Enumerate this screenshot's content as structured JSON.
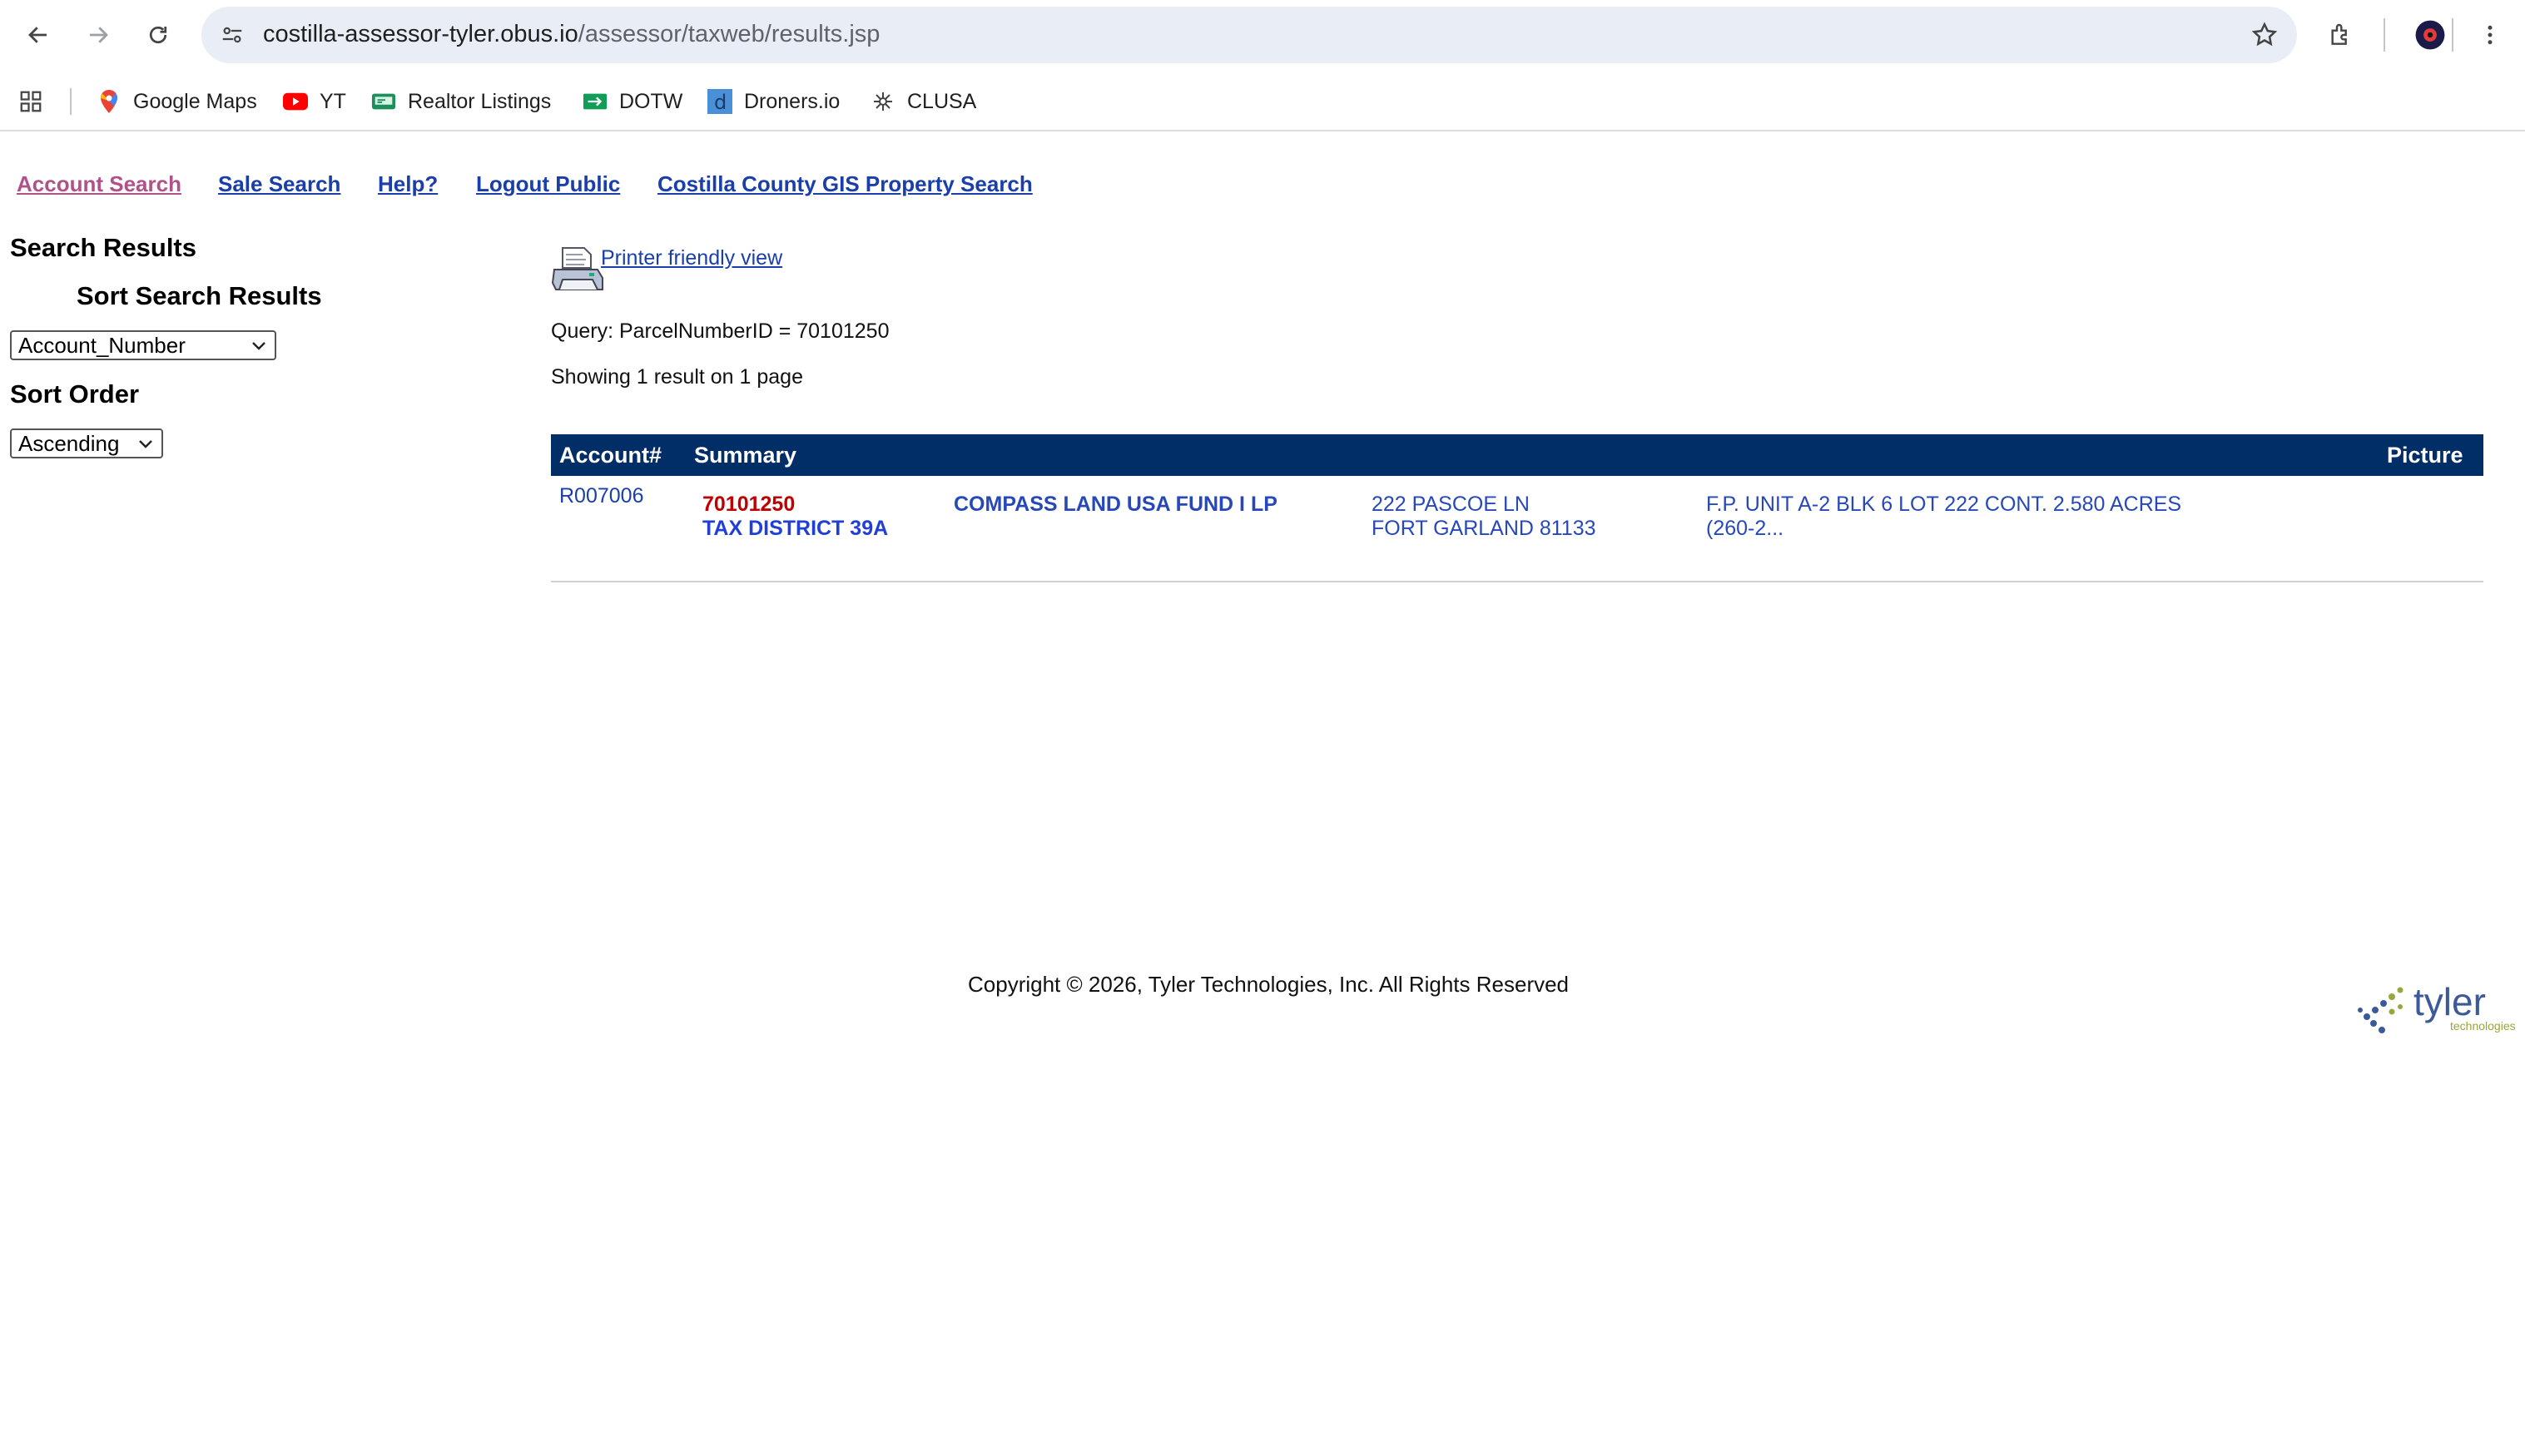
{
  "browser": {
    "url_host": "costilla-assessor-tyler.obus.io",
    "url_path": "/assessor/taxweb/results.jsp",
    "bookmarks": [
      {
        "label": "Google Maps",
        "icon": "google-maps-icon"
      },
      {
        "label": "YT",
        "icon": "youtube-icon"
      },
      {
        "label": "Realtor Listings",
        "icon": "realtor-icon"
      },
      {
        "label": "DOTW",
        "icon": "dotw-icon"
      },
      {
        "label": "Droners.io",
        "icon": "droners-icon"
      },
      {
        "label": "CLUSA",
        "icon": "clusa-icon"
      }
    ]
  },
  "nav": {
    "account_search": "Account Search",
    "sale_search": "Sale Search",
    "help": "Help?",
    "logout": "Logout Public",
    "gis": "Costilla County GIS Property Search"
  },
  "sidebar": {
    "title": "Search Results",
    "sort_title": "Sort Search Results",
    "sort_field": "Account_Number",
    "order_title": "Sort Order",
    "order_value": "Ascending"
  },
  "main": {
    "printer_link": "Printer friendly view",
    "query": "Query: ParcelNumberID = 70101250",
    "showing": "Showing 1 result on 1 page",
    "columns": {
      "account": "Account#",
      "summary": "Summary",
      "picture": "Picture"
    },
    "rows": [
      {
        "account": "R007006",
        "parcel": "70101250",
        "district": "TAX DISTRICT 39A",
        "owner": "COMPASS LAND USA FUND I LP",
        "address1": "222 PASCOE LN",
        "address2": "FORT GARLAND 81133",
        "legal1": "F.P. UNIT A-2 BLK 6 LOT 222 CONT. 2.580 ACRES",
        "legal2": "(260-2..."
      }
    ]
  },
  "footer": {
    "copyright": "Copyright © 2026, Tyler Technologies, Inc. All Rights Reserved",
    "logo_word": "tyler",
    "logo_sub": "technologies"
  },
  "colors": {
    "header_bg": "#022e68",
    "link": "#1a3fa8",
    "visited": "#b05289",
    "parcel_red": "#c00000",
    "district_blue": "#1f3fd6"
  }
}
